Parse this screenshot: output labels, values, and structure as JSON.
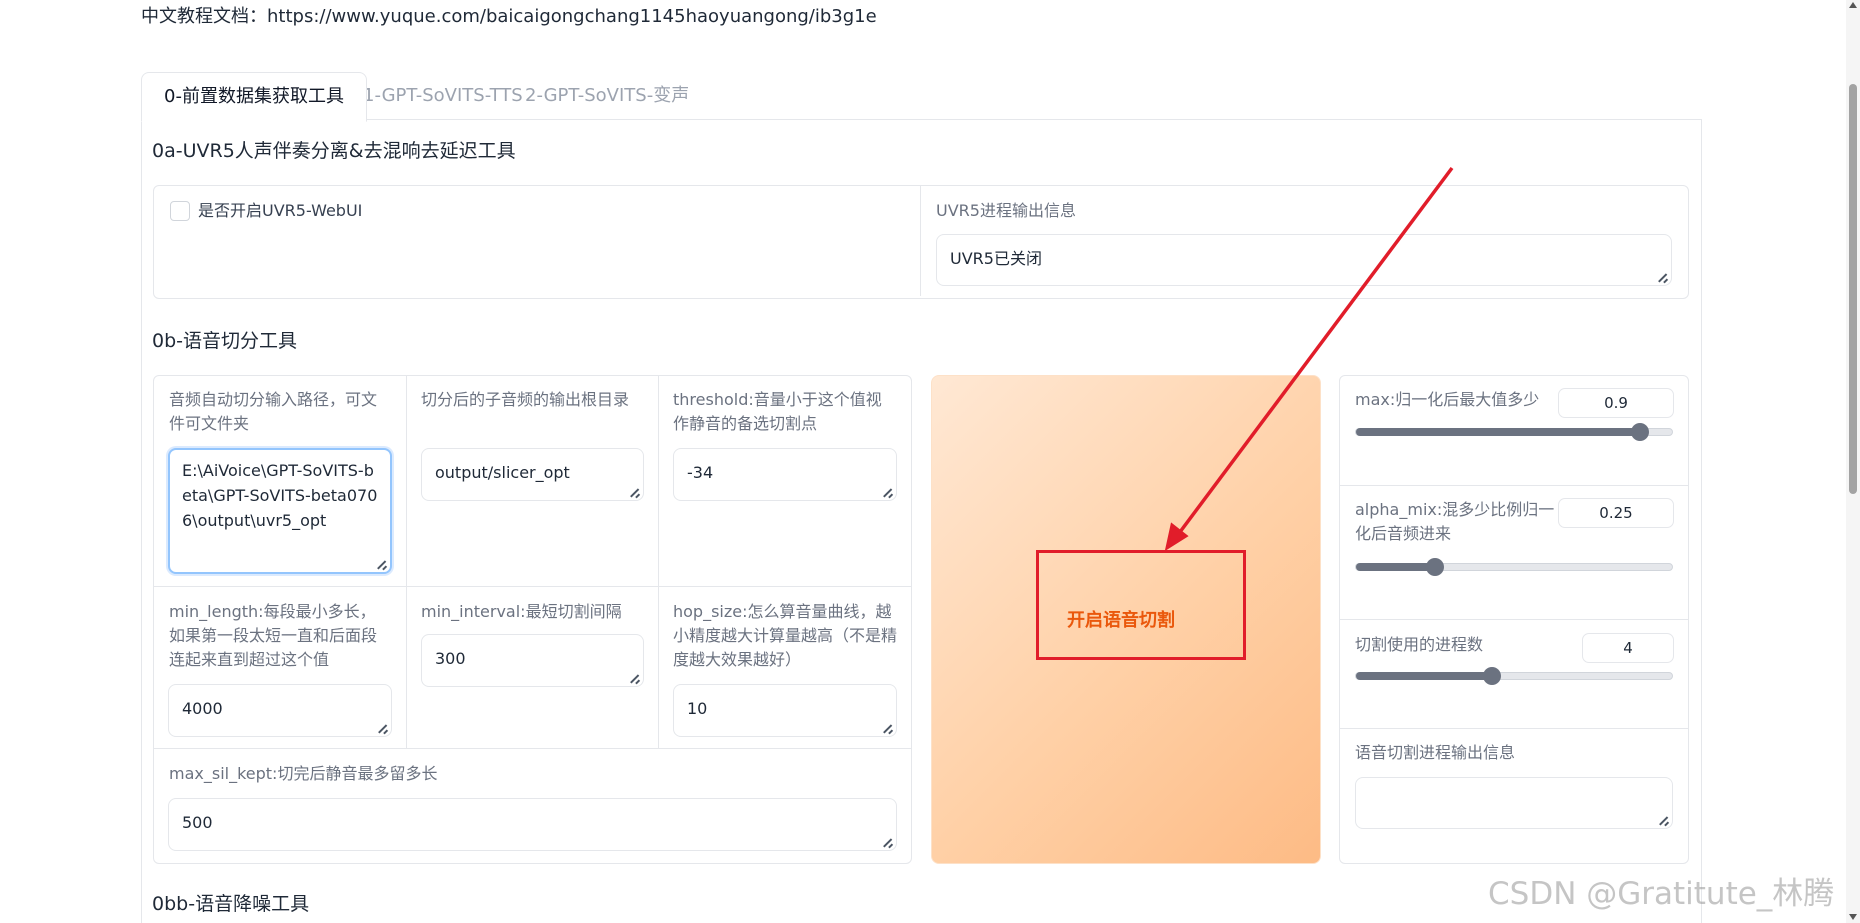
{
  "doc_link": "中文教程文档：https://www.yuque.com/baicaigongchang1145haoyuangong/ib3g1e",
  "tabs": [
    {
      "label": "0-前置数据集获取工具",
      "active": true
    },
    {
      "label": "1-GPT-SoVITS-TTS",
      "active": false
    },
    {
      "label": "2-GPT-SoVITS-变声",
      "active": false
    }
  ],
  "uvr5": {
    "title": "0a-UVR5人声伴奏分离&去混响去延迟工具",
    "checkbox_label": "是否开启UVR5-WebUI",
    "checked": false,
    "output_label": "UVR5进程输出信息",
    "output_value": "UVR5已关闭"
  },
  "slicer": {
    "title": "0b-语音切分工具",
    "input_path_label": "音频自动切分输入路径，可文件可文件夹",
    "input_path_value": "E:\\AiVoice\\GPT-SoVITS-beta\\GPT-SoVITS-beta0706\\output\\uvr5_opt",
    "output_root_label": "切分后的子音频的输出根目录",
    "output_root_value": "output/slicer_opt",
    "threshold_label": "threshold:音量小于这个值视作静音的备选切割点",
    "threshold_value": "-34",
    "min_length_label": "min_length:每段最小多长，如果第一段太短一直和后面段连起来直到超过这个值",
    "min_length_value": "4000",
    "min_interval_label": "min_interval:最短切割间隔",
    "min_interval_value": "300",
    "hop_size_label": "hop_size:怎么算音量曲线，越小精度越大计算量越高（不是精度越大效果越好）",
    "hop_size_value": "10",
    "max_sil_kept_label": "max_sil_kept:切完后静音最多留多长",
    "max_sil_kept_value": "500",
    "start_button": "开启语音切割",
    "max_label": "max:归一化后最大值多少",
    "max_value": "0.9",
    "max_fraction": 0.9,
    "alpha_mix_label": "alpha_mix:混多少比例归一化后音频进来",
    "alpha_mix_value": "0.25",
    "alpha_mix_fraction": 0.25,
    "n_process_label": "切割使用的进程数",
    "n_process_value": "4",
    "n_process_fraction": 0.43,
    "slicer_output_label": "语音切割进程输出信息",
    "slicer_output_value": ""
  },
  "denoise": {
    "title": "0bb-语音降噪工具"
  },
  "watermark": "CSDN @Gratitute_林腾",
  "colors": {
    "annotation": "#e11d2a",
    "button_text": "#ea580c",
    "focus_border": "#93c5fd"
  }
}
